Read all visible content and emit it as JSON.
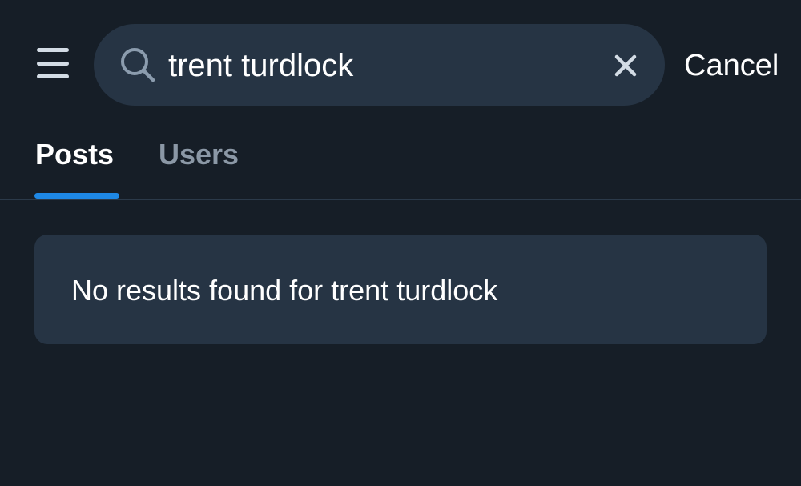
{
  "header": {
    "menu_icon": "hamburger-menu-icon",
    "search": {
      "icon": "search-icon",
      "value": "trent turdlock",
      "clear_icon": "close-icon"
    },
    "cancel_label": "Cancel"
  },
  "tabs": [
    {
      "label": "Posts",
      "active": true
    },
    {
      "label": "Users",
      "active": false
    }
  ],
  "results": {
    "empty_message": "No results found for trent turdlock"
  },
  "colors": {
    "background": "#161e27",
    "surface": "#263444",
    "accent": "#1e88e5",
    "text_primary": "#ffffff",
    "text_muted": "#8b98a6"
  }
}
